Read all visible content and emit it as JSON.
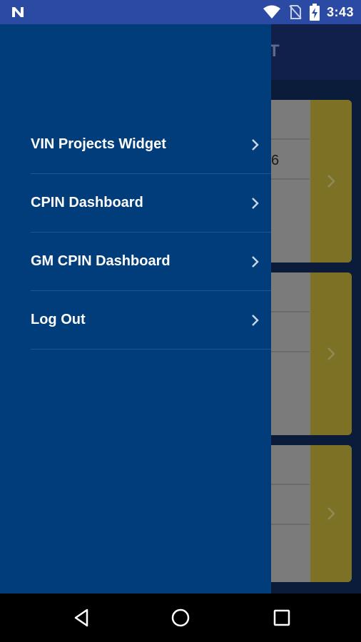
{
  "status_bar": {
    "time": "3:43",
    "icons": [
      "n-notification-icon",
      "wifi-icon",
      "no-sim-icon",
      "battery-charging-icon"
    ],
    "bg_color": "#2b4aa3"
  },
  "background_app": {
    "title_fragment": "ET",
    "card_value_fragment": "6",
    "accent_color": "#7c7124"
  },
  "drawer": {
    "bg_color": "#003d7a",
    "items": [
      {
        "label": "VIN Projects Widget"
      },
      {
        "label": "CPIN Dashboard"
      },
      {
        "label": "GM CPIN Dashboard"
      },
      {
        "label": "Log Out"
      }
    ]
  },
  "nav_bar": {
    "buttons": [
      "back-icon",
      "home-icon",
      "recents-icon"
    ]
  }
}
